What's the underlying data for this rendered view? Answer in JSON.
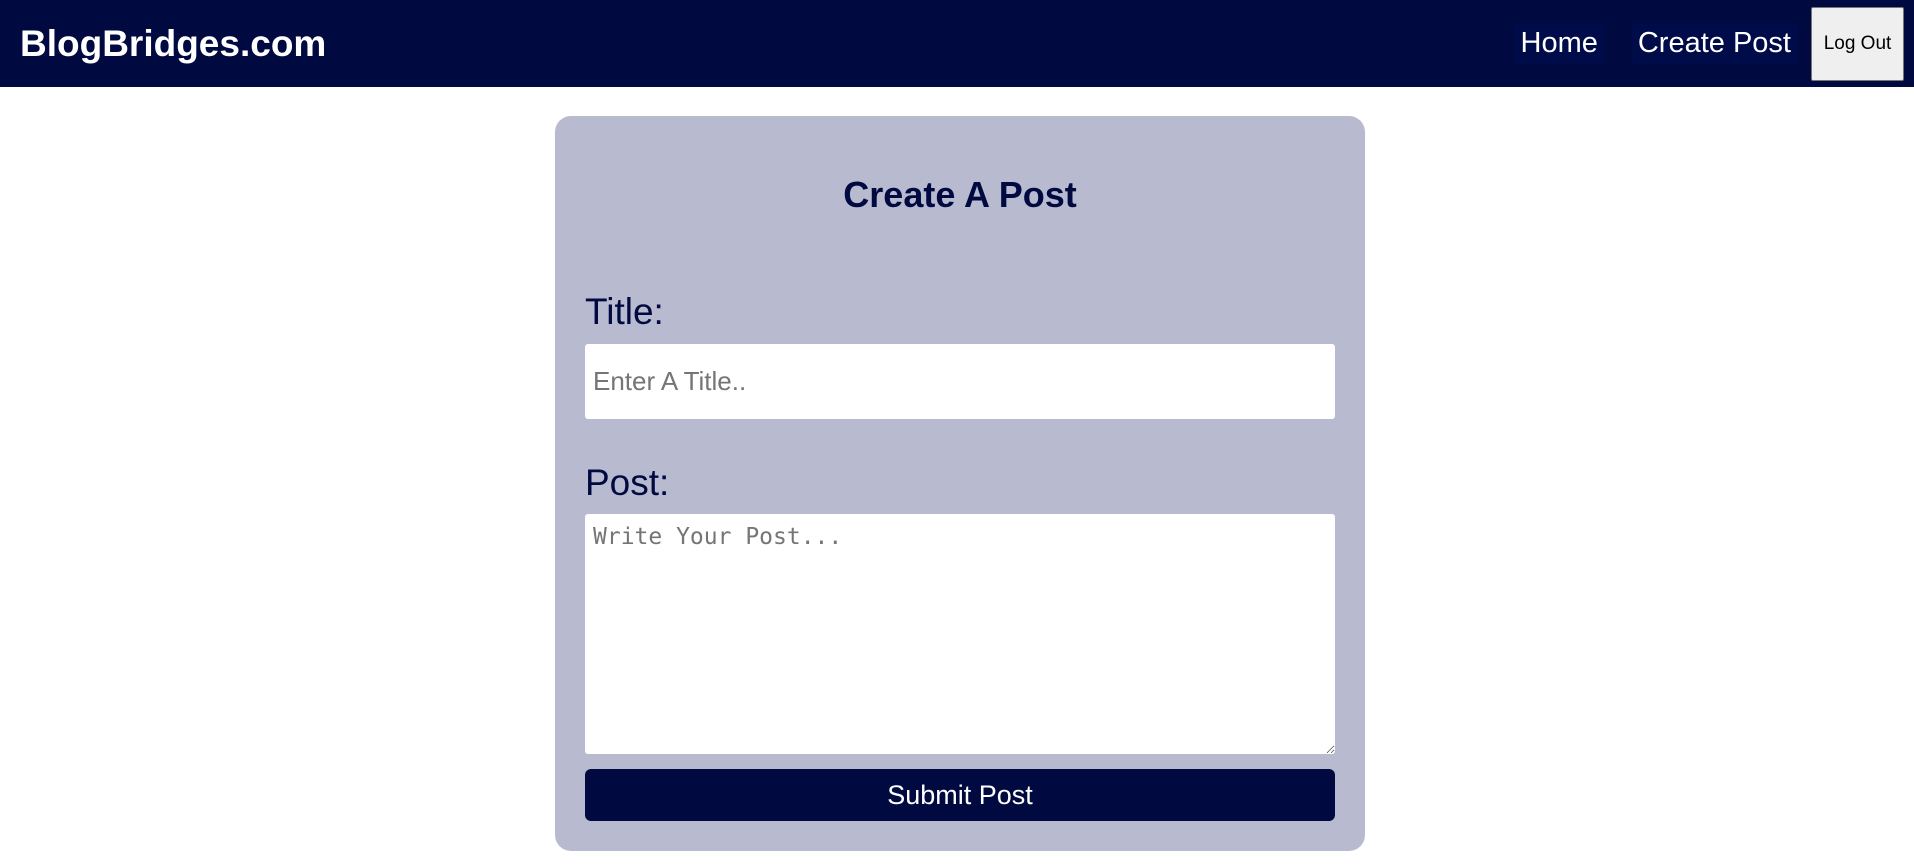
{
  "navbar": {
    "brand": "BlogBridges.com",
    "links": [
      {
        "label": "Home"
      },
      {
        "label": "Create Post"
      }
    ],
    "logout_label": "Log Out"
  },
  "form": {
    "heading": "Create A Post",
    "title_label": "Title:",
    "title_placeholder": "Enter A Title..",
    "title_value": "",
    "post_label": "Post:",
    "post_placeholder": "Write Your Post...",
    "post_value": "",
    "submit_label": "Submit Post"
  },
  "colors": {
    "navbar_bg": "#000a40",
    "card_bg": "#b8bbcf",
    "accent": "#000a40"
  }
}
